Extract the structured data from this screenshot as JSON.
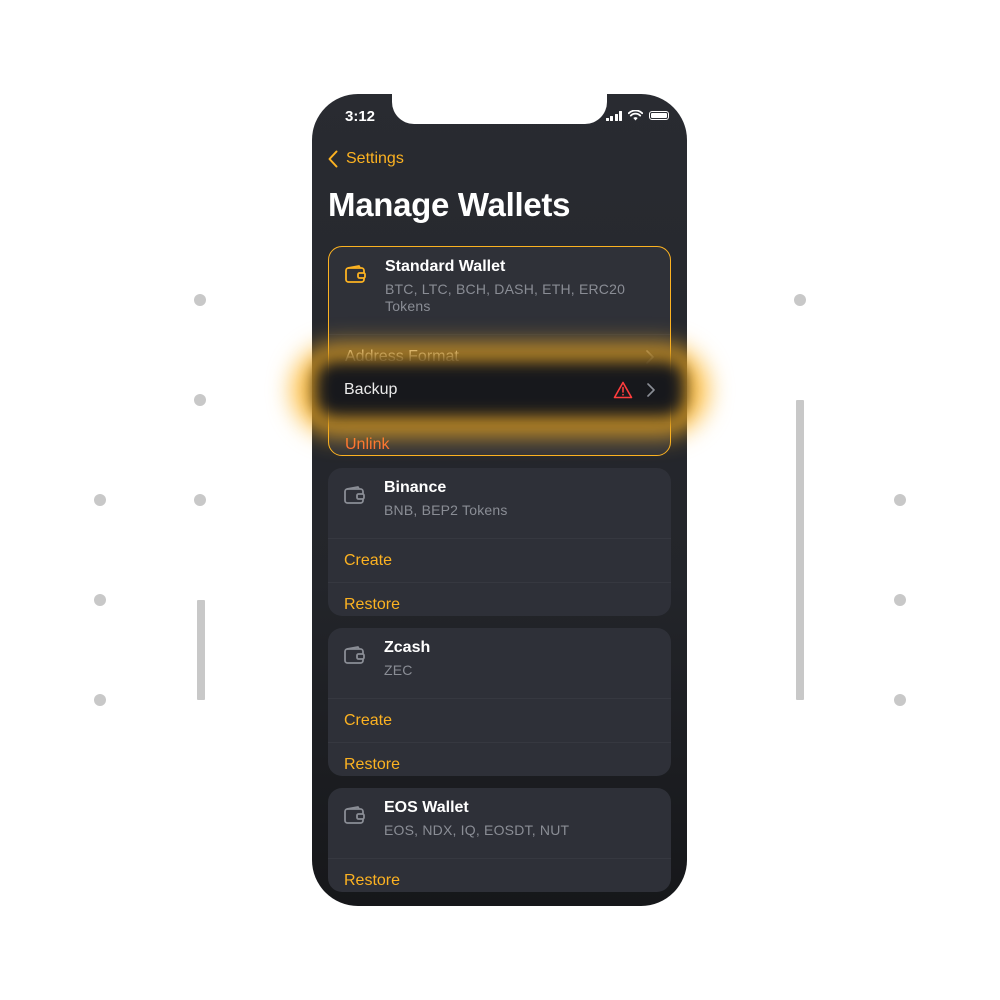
{
  "status": {
    "time": "3:12"
  },
  "nav": {
    "back_label": "Settings"
  },
  "title": "Manage Wallets",
  "icons": {
    "back": "chevron-left-icon",
    "wallet": "wallet-icon",
    "warning": "warning-icon",
    "chevron": "chevron-right-icon"
  },
  "colors": {
    "accent": "#fcb221",
    "danger": "#ff6a34",
    "card": "#2e3038",
    "background": "#292b31"
  },
  "wallets": [
    {
      "name": "Standard Wallet",
      "coins": "BTC, LTC, BCH, DASH, ETH, ERC20 Tokens",
      "linked": true,
      "actions": [
        "Address Format",
        "Backup",
        "Unlink"
      ]
    },
    {
      "name": "Binance",
      "coins": "BNB, BEP2 Tokens",
      "actions": [
        "Create",
        "Restore"
      ]
    },
    {
      "name": "Zcash",
      "coins": "ZEC",
      "actions": [
        "Create",
        "Restore"
      ]
    },
    {
      "name": "EOS Wallet",
      "coins": "EOS, NDX, IQ, EOSDT, NUT",
      "actions": [
        "Restore"
      ]
    }
  ]
}
